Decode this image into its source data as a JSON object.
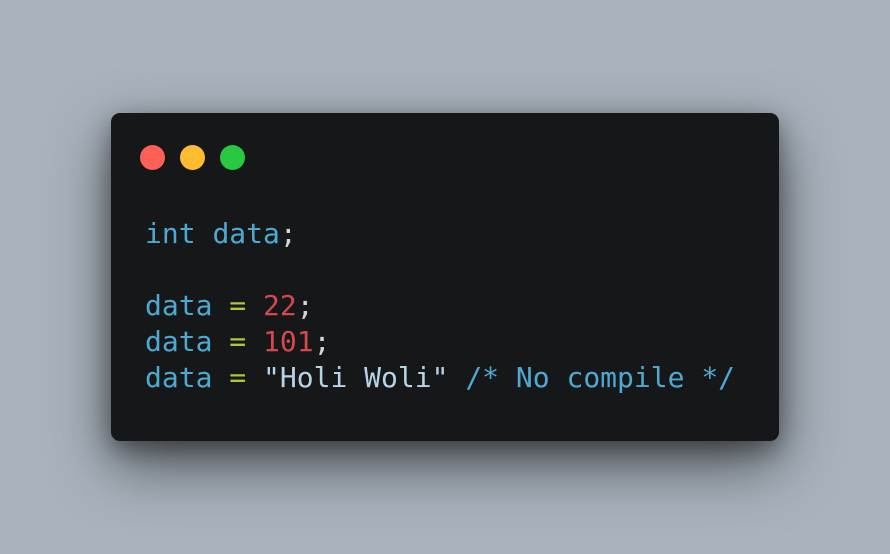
{
  "window_controls": {
    "close_color": "#fe5f57",
    "minimize_color": "#febc2e",
    "maximize_color": "#28c840"
  },
  "code": {
    "line1": {
      "keyword": "int",
      "identifier": "data",
      "end": ";"
    },
    "line3": {
      "identifier": "data",
      "operator": "=",
      "value": "22",
      "end": ";"
    },
    "line4": {
      "identifier": "data",
      "operator": "=",
      "value": "101",
      "end": ";"
    },
    "line5": {
      "identifier": "data",
      "operator": "=",
      "value": "\"Holi Woli\"",
      "comment": "/* No compile */"
    }
  }
}
